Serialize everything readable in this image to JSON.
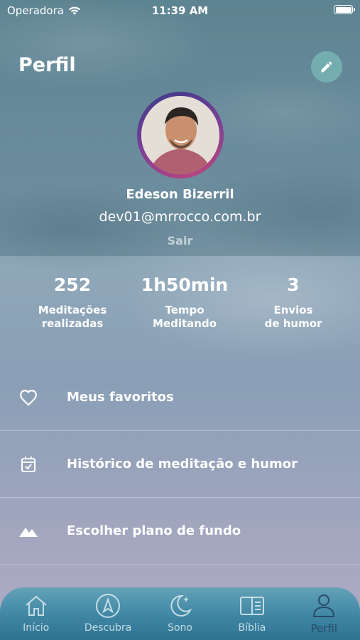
{
  "status_bar": {
    "carrier": "Operadora",
    "time": "11:39 AM",
    "battery_level": 1.0
  },
  "header": {
    "title": "Perfil",
    "edit_icon": "pencil-icon"
  },
  "profile": {
    "name": "Edeson Bizerril",
    "email": "dev01@mrrocco.com.br",
    "logout_label": "Sair",
    "avatar_ring_colors": [
      "#3b3b8a",
      "#7a3f96",
      "#c2487a"
    ]
  },
  "stats": [
    {
      "value": "252",
      "label": "Meditações\nrealizadas"
    },
    {
      "value": "1h50min",
      "label": "Tempo\nMeditando"
    },
    {
      "value": "3",
      "label": "Envios\nde humor"
    }
  ],
  "menu": [
    {
      "label": "Meus favoritos",
      "icon": "heart-icon"
    },
    {
      "label": "Histórico de meditação e humor",
      "icon": "calendar-check-icon"
    },
    {
      "label": "Escolher plano de fundo",
      "icon": "mountains-icon"
    }
  ],
  "tabs": [
    {
      "label": "Início",
      "icon": "home-icon",
      "active": false
    },
    {
      "label": "Descubra",
      "icon": "compass-icon",
      "active": false
    },
    {
      "label": "Sono",
      "icon": "moon-star-icon",
      "active": false
    },
    {
      "label": "Bíblia",
      "icon": "book-icon",
      "active": false
    },
    {
      "label": "Perfil",
      "icon": "person-icon",
      "active": true
    }
  ],
  "colors": {
    "accent": "#3f86a4",
    "active_tab": "#2a4a6a",
    "edit_button": "#78b4b4"
  }
}
